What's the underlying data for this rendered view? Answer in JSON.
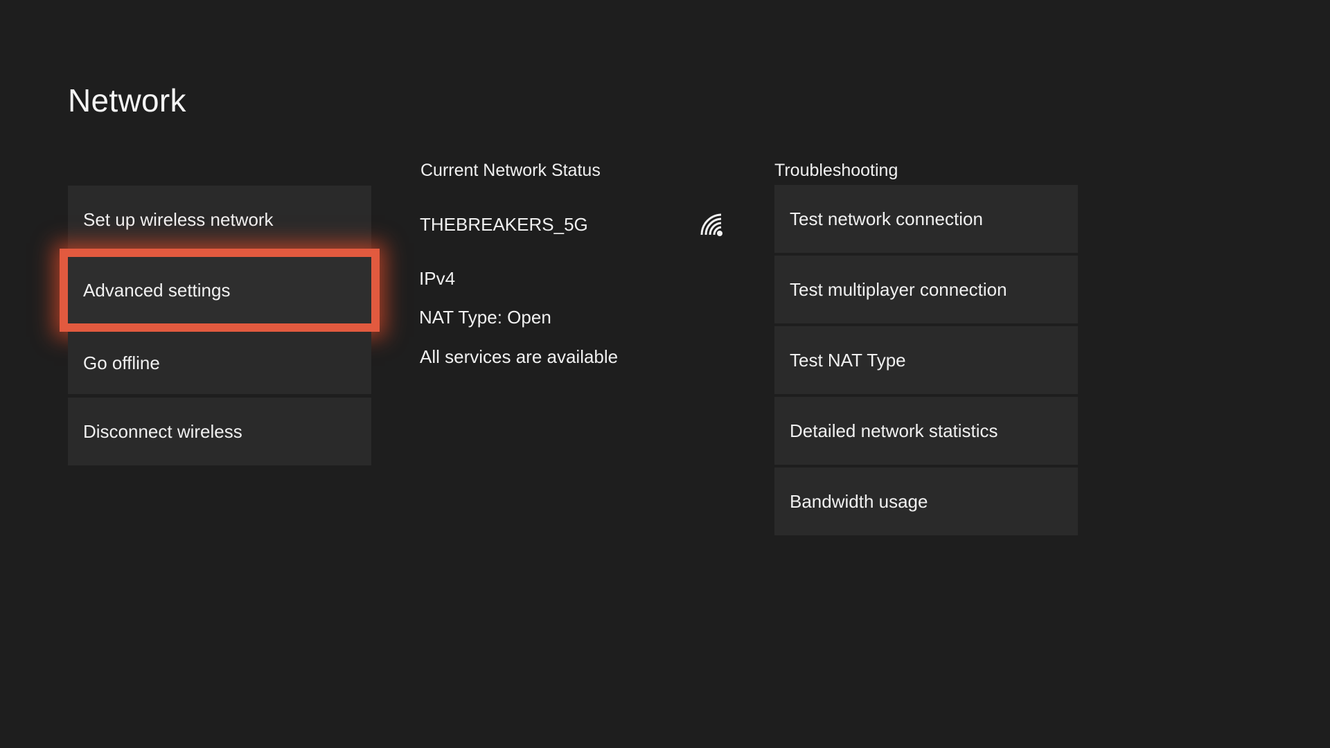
{
  "page": {
    "title": "Network"
  },
  "colors": {
    "focus": "#e25a3f",
    "background": "#1e1e1e",
    "tile": "#2a2a2a"
  },
  "left_menu": {
    "items": [
      {
        "label": "Set up wireless network"
      },
      {
        "label": "Advanced settings",
        "focused": true
      },
      {
        "label": "Go offline"
      },
      {
        "label": "Disconnect wireless"
      }
    ]
  },
  "status": {
    "heading": "Current Network Status",
    "network_name": "THEBREAKERS_5G",
    "signal_icon": "wifi-signal-icon",
    "ip_version": "IPv4",
    "nat_type": "NAT Type: Open",
    "services": "All services are available"
  },
  "troubleshooting": {
    "heading": "Troubleshooting",
    "items": [
      {
        "label": "Test network connection"
      },
      {
        "label": "Test multiplayer connection"
      },
      {
        "label": "Test NAT Type"
      },
      {
        "label": "Detailed network statistics"
      },
      {
        "label": "Bandwidth usage"
      }
    ]
  }
}
